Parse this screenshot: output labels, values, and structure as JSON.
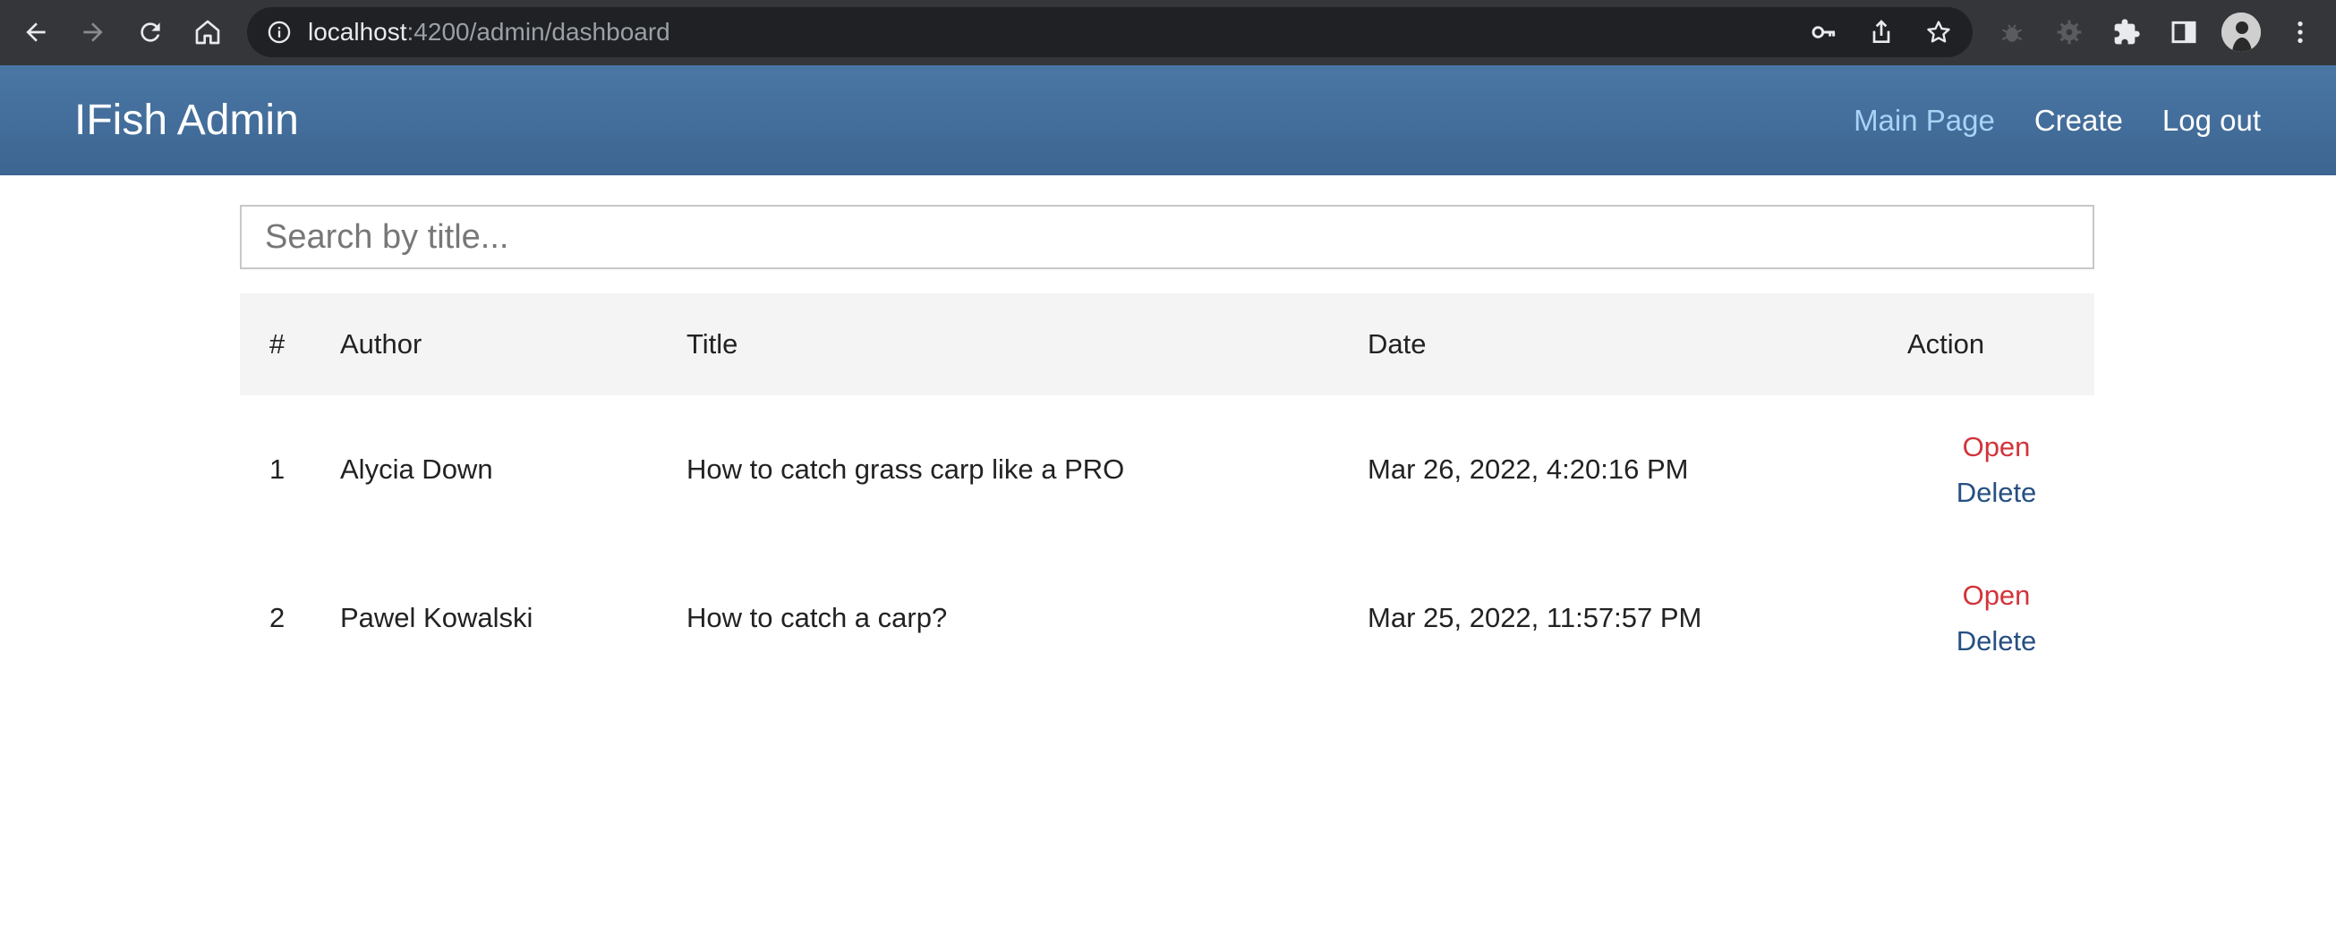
{
  "browser": {
    "url_host": "localhost",
    "url_path": ":4200/admin/dashboard"
  },
  "navbar": {
    "brand": "IFish Admin",
    "links": [
      {
        "label": "Main Page",
        "active": true
      },
      {
        "label": "Create",
        "active": false
      },
      {
        "label": "Log out",
        "active": false
      }
    ]
  },
  "search": {
    "placeholder": "Search by title...",
    "value": ""
  },
  "table": {
    "headers": [
      "#",
      "Author",
      "Title",
      "Date",
      "Action"
    ],
    "rows": [
      {
        "num": "1",
        "author": "Alycia Down",
        "title": "How to catch grass carp like a PRO",
        "date": "Mar 26, 2022, 4:20:16 PM",
        "open_label": "Open",
        "delete_label": "Delete"
      },
      {
        "num": "2",
        "author": "Pawel Kowalski",
        "title": "How to catch a carp?",
        "date": "Mar 25, 2022, 11:57:57 PM",
        "open_label": "Open",
        "delete_label": "Delete"
      }
    ]
  },
  "colors": {
    "navbar": "#4a77a5",
    "active_link": "#a9d2f7",
    "open_link": "#d2333a",
    "delete_link": "#274f82"
  }
}
